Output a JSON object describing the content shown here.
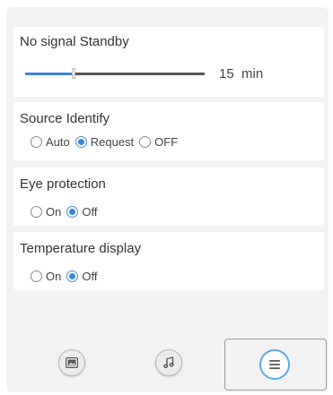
{
  "standby": {
    "title": "No signal Standby",
    "value": "15",
    "unit": "min",
    "level_fraction": 0.27
  },
  "source": {
    "title": "Source Identify",
    "options": [
      "Auto",
      "Request",
      "OFF"
    ],
    "selected": "Request"
  },
  "eye": {
    "title": "Eye protection",
    "options": [
      "On",
      "Off"
    ],
    "selected": "Off"
  },
  "temperature": {
    "title": "Temperature display",
    "options": [
      "On",
      "Off"
    ],
    "selected": "Off"
  },
  "bottom_bar": {
    "icons": [
      "picture-icon",
      "music-icon",
      "menu-icon"
    ],
    "selected": "menu-icon"
  },
  "colors": {
    "accent": "#3b86d9",
    "panel": "#f2f2f2",
    "card": "#ffffff"
  }
}
